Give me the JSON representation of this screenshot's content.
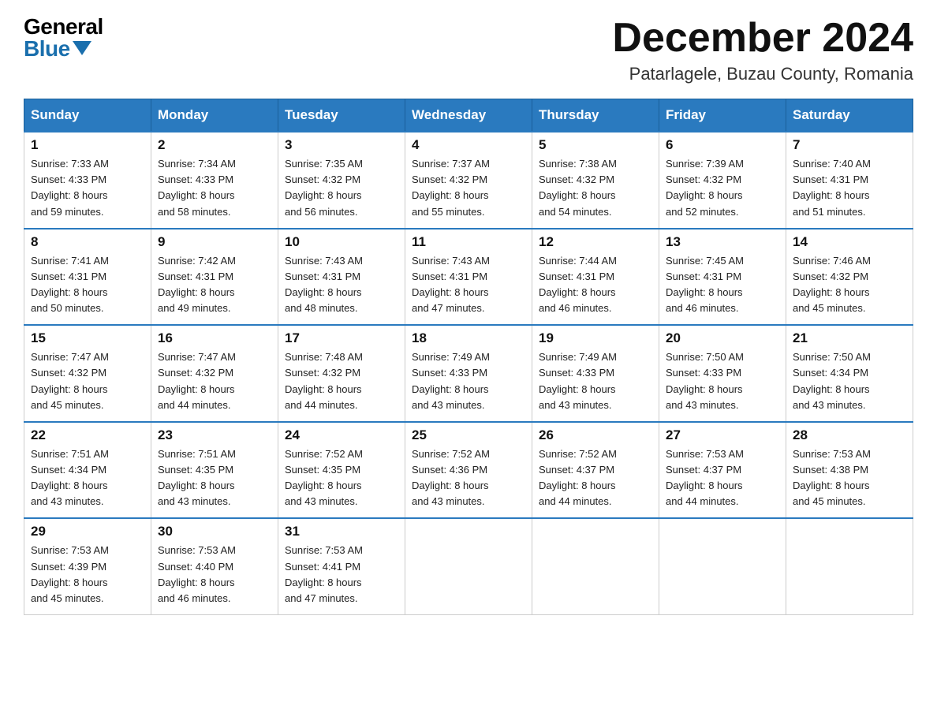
{
  "header": {
    "logo_general": "General",
    "logo_blue": "Blue",
    "month_title": "December 2024",
    "location": "Patarlagele, Buzau County, Romania"
  },
  "days_of_week": [
    "Sunday",
    "Monday",
    "Tuesday",
    "Wednesday",
    "Thursday",
    "Friday",
    "Saturday"
  ],
  "weeks": [
    [
      {
        "num": "1",
        "sunrise": "7:33 AM",
        "sunset": "4:33 PM",
        "daylight": "8 hours and 59 minutes."
      },
      {
        "num": "2",
        "sunrise": "7:34 AM",
        "sunset": "4:33 PM",
        "daylight": "8 hours and 58 minutes."
      },
      {
        "num": "3",
        "sunrise": "7:35 AM",
        "sunset": "4:32 PM",
        "daylight": "8 hours and 56 minutes."
      },
      {
        "num": "4",
        "sunrise": "7:37 AM",
        "sunset": "4:32 PM",
        "daylight": "8 hours and 55 minutes."
      },
      {
        "num": "5",
        "sunrise": "7:38 AM",
        "sunset": "4:32 PM",
        "daylight": "8 hours and 54 minutes."
      },
      {
        "num": "6",
        "sunrise": "7:39 AM",
        "sunset": "4:32 PM",
        "daylight": "8 hours and 52 minutes."
      },
      {
        "num": "7",
        "sunrise": "7:40 AM",
        "sunset": "4:31 PM",
        "daylight": "8 hours and 51 minutes."
      }
    ],
    [
      {
        "num": "8",
        "sunrise": "7:41 AM",
        "sunset": "4:31 PM",
        "daylight": "8 hours and 50 minutes."
      },
      {
        "num": "9",
        "sunrise": "7:42 AM",
        "sunset": "4:31 PM",
        "daylight": "8 hours and 49 minutes."
      },
      {
        "num": "10",
        "sunrise": "7:43 AM",
        "sunset": "4:31 PM",
        "daylight": "8 hours and 48 minutes."
      },
      {
        "num": "11",
        "sunrise": "7:43 AM",
        "sunset": "4:31 PM",
        "daylight": "8 hours and 47 minutes."
      },
      {
        "num": "12",
        "sunrise": "7:44 AM",
        "sunset": "4:31 PM",
        "daylight": "8 hours and 46 minutes."
      },
      {
        "num": "13",
        "sunrise": "7:45 AM",
        "sunset": "4:31 PM",
        "daylight": "8 hours and 46 minutes."
      },
      {
        "num": "14",
        "sunrise": "7:46 AM",
        "sunset": "4:32 PM",
        "daylight": "8 hours and 45 minutes."
      }
    ],
    [
      {
        "num": "15",
        "sunrise": "7:47 AM",
        "sunset": "4:32 PM",
        "daylight": "8 hours and 45 minutes."
      },
      {
        "num": "16",
        "sunrise": "7:47 AM",
        "sunset": "4:32 PM",
        "daylight": "8 hours and 44 minutes."
      },
      {
        "num": "17",
        "sunrise": "7:48 AM",
        "sunset": "4:32 PM",
        "daylight": "8 hours and 44 minutes."
      },
      {
        "num": "18",
        "sunrise": "7:49 AM",
        "sunset": "4:33 PM",
        "daylight": "8 hours and 43 minutes."
      },
      {
        "num": "19",
        "sunrise": "7:49 AM",
        "sunset": "4:33 PM",
        "daylight": "8 hours and 43 minutes."
      },
      {
        "num": "20",
        "sunrise": "7:50 AM",
        "sunset": "4:33 PM",
        "daylight": "8 hours and 43 minutes."
      },
      {
        "num": "21",
        "sunrise": "7:50 AM",
        "sunset": "4:34 PM",
        "daylight": "8 hours and 43 minutes."
      }
    ],
    [
      {
        "num": "22",
        "sunrise": "7:51 AM",
        "sunset": "4:34 PM",
        "daylight": "8 hours and 43 minutes."
      },
      {
        "num": "23",
        "sunrise": "7:51 AM",
        "sunset": "4:35 PM",
        "daylight": "8 hours and 43 minutes."
      },
      {
        "num": "24",
        "sunrise": "7:52 AM",
        "sunset": "4:35 PM",
        "daylight": "8 hours and 43 minutes."
      },
      {
        "num": "25",
        "sunrise": "7:52 AM",
        "sunset": "4:36 PM",
        "daylight": "8 hours and 43 minutes."
      },
      {
        "num": "26",
        "sunrise": "7:52 AM",
        "sunset": "4:37 PM",
        "daylight": "8 hours and 44 minutes."
      },
      {
        "num": "27",
        "sunrise": "7:53 AM",
        "sunset": "4:37 PM",
        "daylight": "8 hours and 44 minutes."
      },
      {
        "num": "28",
        "sunrise": "7:53 AM",
        "sunset": "4:38 PM",
        "daylight": "8 hours and 45 minutes."
      }
    ],
    [
      {
        "num": "29",
        "sunrise": "7:53 AM",
        "sunset": "4:39 PM",
        "daylight": "8 hours and 45 minutes."
      },
      {
        "num": "30",
        "sunrise": "7:53 AM",
        "sunset": "4:40 PM",
        "daylight": "8 hours and 46 minutes."
      },
      {
        "num": "31",
        "sunrise": "7:53 AM",
        "sunset": "4:41 PM",
        "daylight": "8 hours and 47 minutes."
      },
      null,
      null,
      null,
      null
    ]
  ],
  "labels": {
    "sunrise": "Sunrise:",
    "sunset": "Sunset:",
    "daylight": "Daylight:"
  }
}
